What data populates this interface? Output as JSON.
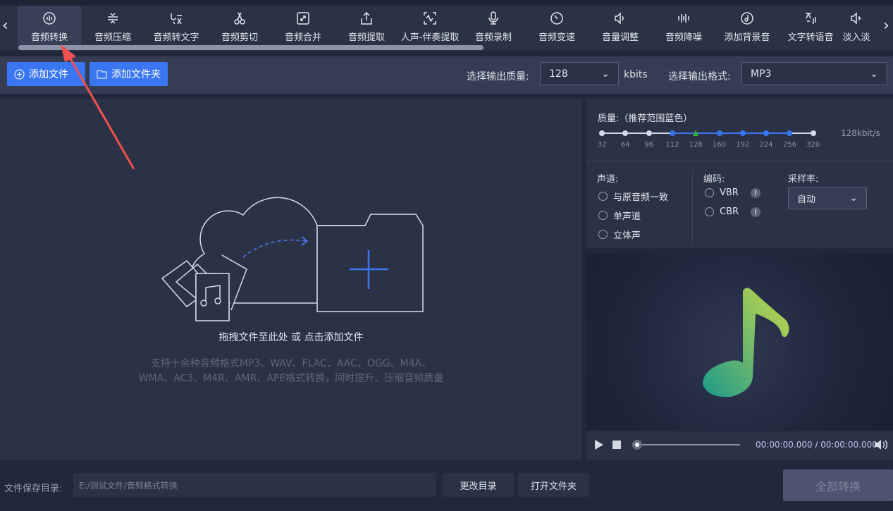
{
  "tabs": [
    {
      "label": "音频转换",
      "icon": "audio-convert-icon",
      "active": true
    },
    {
      "label": "音频压缩",
      "icon": "compress-icon"
    },
    {
      "label": "音频转文字",
      "icon": "speech-to-text-icon"
    },
    {
      "label": "音频剪切",
      "icon": "scissors-icon"
    },
    {
      "label": "音频合并",
      "icon": "merge-icon"
    },
    {
      "label": "音频提取",
      "icon": "extract-icon"
    },
    {
      "label": "人声-伴奏提取",
      "icon": "vocal-extract-icon"
    },
    {
      "label": "音频录制",
      "icon": "microphone-icon"
    },
    {
      "label": "音频变速",
      "icon": "speed-icon"
    },
    {
      "label": "音量调整",
      "icon": "volume-icon"
    },
    {
      "label": "音频降噪",
      "icon": "denoise-icon"
    },
    {
      "label": "添加背景音",
      "icon": "background-music-icon"
    },
    {
      "label": "文字转语音",
      "icon": "text-to-speech-icon"
    },
    {
      "label": "淡入淡",
      "icon": "fade-icon"
    }
  ],
  "toolbar": {
    "add_file": "添加文件",
    "add_folder": "添加文件夹",
    "quality_label": "选择输出质量:",
    "quality_value": "128",
    "quality_unit": "kbits",
    "format_label": "选择输出格式:",
    "format_value": "MP3"
  },
  "dropzone": {
    "main_text": "拖拽文件至此处 或 点击添加文件",
    "hint_line1": "支持十余种音频格式MP3、WAV、FLAC、AAC、OGG、M4A、",
    "hint_line2": "WMA、AC3、M4R、AMR、APE格式转换，同时提升、压缩音频质量"
  },
  "settings": {
    "quality_title": "质量:（推荐范围蓝色）",
    "quality_ticks": [
      "32",
      "64",
      "96",
      "112",
      "128",
      "160",
      "192",
      "224",
      "256",
      "320"
    ],
    "quality_selected_index": 4,
    "recommended_range": [
      3,
      8
    ],
    "quality_readout": "128kbit/s",
    "channel_label": "声道:",
    "channels": [
      "与原音频一致",
      "单声道",
      "立体声"
    ],
    "encoding_label": "编码:",
    "encodings": [
      "VBR",
      "CBR"
    ],
    "samplerate_label": "采样率:",
    "samplerate_value": "自动"
  },
  "player": {
    "time": "00:00:00.000 / 00:00:00.000",
    "progress": 0
  },
  "footer": {
    "save_dir_label": "文件保存目录:",
    "save_dir_value": "E:/测试文件/音频格式转换",
    "change_dir": "更改目录",
    "open_folder": "打开文件夹",
    "convert_all": "全部转换"
  },
  "colors": {
    "accent": "#3b76f2",
    "selected": "#2fb52f",
    "arrow": "#f0504f"
  }
}
